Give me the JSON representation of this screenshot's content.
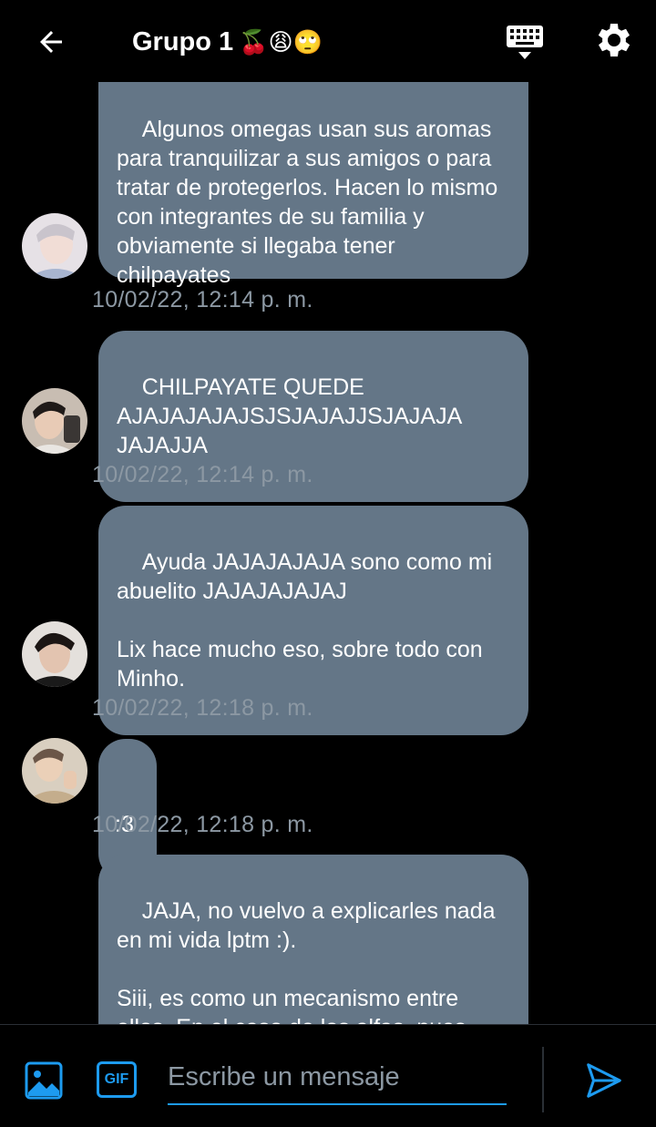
{
  "header": {
    "title": "Grupo 1",
    "title_emojis": "🍒😩🙄",
    "back_icon": "arrow-left-icon",
    "keyboard_icon": "keyboard-icon",
    "settings_icon": "gear-icon"
  },
  "messages": [
    {
      "text": "Algunos omegas usan sus aromas para tranquilizar a sus amigos o para tratar de protegerlos. Hacen lo mismo con integrantes de su familia y obviamente si llegaba tener chilpayates",
      "time": "10/02/22, 12:14 p. m.",
      "avatar_color": "#d9d4da"
    },
    {
      "text": "CHILPAYATE QUEDE AJAJAJAJAJSJSJAJAJJSJAJAJA JAJAJJA",
      "time": "10/02/22, 12:14 p. m.",
      "avatar_color": "#8b7467"
    },
    {
      "text": "Ayuda JAJAJAJAJA sono como mi abuelito JAJAJAJAJAJ\n\nLix hace mucho eso, sobre todo con Minho.",
      "time": "10/02/22, 12:18 p. m.",
      "avatar_color": "#3a2e2b"
    },
    {
      "text": ":3",
      "time": "10/02/22, 12:18 p. m.",
      "avatar_color": "#b7a48a"
    },
    {
      "text": "JAJA, no vuelvo a explicarles nada en mi vida lptm :).\n\nSiii, es como un mecanismo entre ellos. En el caso de los alfas, pues"
    }
  ],
  "composer": {
    "placeholder": "Escribe un mensaje",
    "gif_label": "GIF",
    "image_icon": "image-icon",
    "send_icon": "send-icon",
    "accent": "#1d9bf0"
  },
  "colors": {
    "bubble": "#647687",
    "timestamp": "#8c98a3",
    "background": "#000000"
  }
}
